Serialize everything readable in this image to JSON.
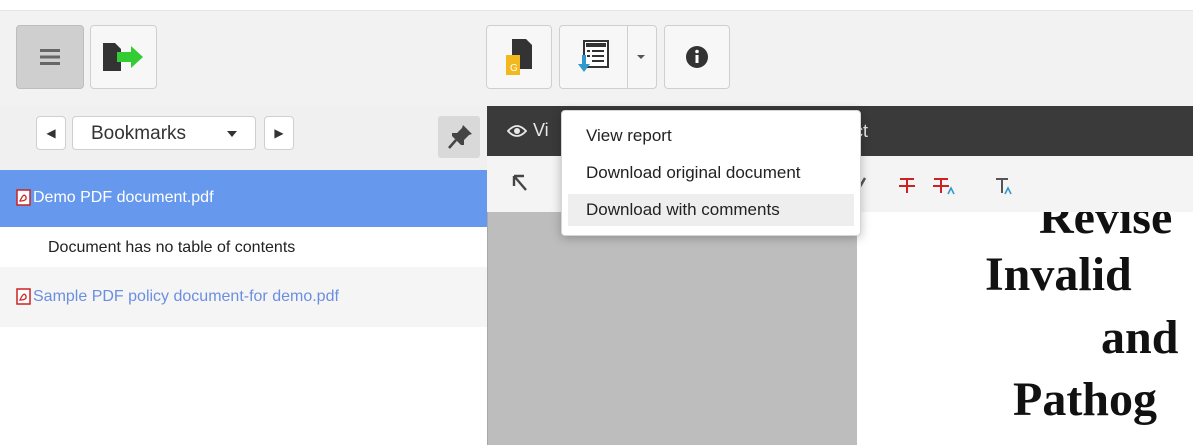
{
  "toolbar": {
    "menu_icon": "hamburger-icon",
    "export_icon": "export-arrow-icon",
    "google_icon": "google-doc-icon",
    "download_icon": "download-report-icon",
    "dropdown_caret_icon": "caret-down-icon",
    "info_icon": "info-icon"
  },
  "sidebar": {
    "prev_icon": "◀",
    "next_icon": "▶",
    "mode_label": "Bookmarks",
    "pin_icon": "pin-icon",
    "items": [
      {
        "label": "Demo PDF document.pdf"
      },
      {
        "label": "Document has no table of contents"
      },
      {
        "label": "Sample PDF policy document-for demo.pdf"
      }
    ]
  },
  "viewer": {
    "header_partial_left": "Vi",
    "header_partial_right": "ct",
    "page_text": [
      "Revise",
      "Invalid",
      "and",
      "Pathog"
    ]
  },
  "download_menu": {
    "items": [
      {
        "label": "View report"
      },
      {
        "label": "Download original document"
      },
      {
        "label": "Download with comments"
      }
    ]
  },
  "colors": {
    "selection_blue": "#6699ee",
    "link_blue": "#6b8fe0",
    "pdf_red": "#cc2222",
    "strike_red": "#cc2222",
    "caret_blue": "#3399cc"
  }
}
